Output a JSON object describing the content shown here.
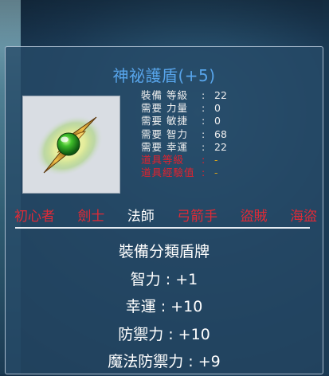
{
  "item": {
    "name": "神祕護盾(+5)",
    "requirements": [
      {
        "label": "裝備 等級",
        "value": "22",
        "met": true
      },
      {
        "label": "需要 力量",
        "value": "0",
        "met": true
      },
      {
        "label": "需要 敏捷",
        "value": "0",
        "met": true
      },
      {
        "label": "需要 智力",
        "value": "68",
        "met": true
      },
      {
        "label": "需要 幸運",
        "value": "22",
        "met": true
      },
      {
        "label": "道具等級",
        "value": "-",
        "met": false
      },
      {
        "label": "道具經驗值",
        "value": "-",
        "met": false
      }
    ],
    "separator": ":",
    "jobs": [
      {
        "label": "初心者",
        "active": false
      },
      {
        "label": "劍士",
        "active": false
      },
      {
        "label": "法師",
        "active": true
      },
      {
        "label": "弓箭手",
        "active": false
      },
      {
        "label": "盜賊",
        "active": false
      },
      {
        "label": "海盜",
        "active": false
      }
    ],
    "stats": [
      "裝備分類盾牌",
      "智力 : +1",
      "幸運 : +10",
      "防禦力 : +10",
      "魔法防禦力 : +9"
    ],
    "icon": "mystic-shield-orb-icon"
  },
  "colors": {
    "title": "#57a4ea",
    "unmet_requirement": "#e5212d",
    "job_inactive": "#e12a36",
    "job_active": "#ffffff"
  }
}
